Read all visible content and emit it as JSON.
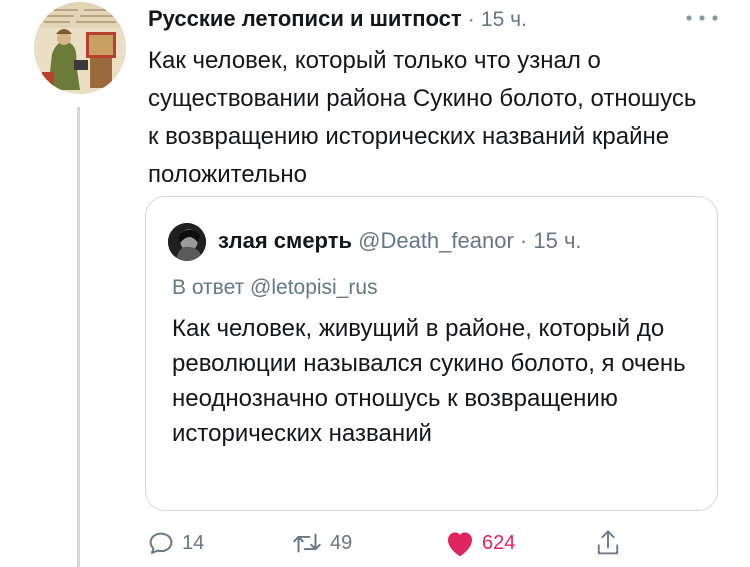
{
  "tweet": {
    "author": "Русские летописи и шитпост",
    "separator": "·",
    "time": "15 ч.",
    "text": "Как человек, который только что узнал о существовании района Сукино болото, отношусь к возвращению исторических названий крайне положительно"
  },
  "quoted_tweet": {
    "author": "злая смерть",
    "handle": "@Death_feanor",
    "separator": "·",
    "time": "15 ч.",
    "reply_to": "В ответ @letopisi_rus",
    "text": "Как человек, живущий в районе, который до революции назывался сукино болото, я очень неоднозначно отношусь к возвращению исторических названий"
  },
  "actions": {
    "replies": "14",
    "retweets": "49",
    "likes": "624"
  },
  "colors": {
    "text": "#14171a",
    "secondary": "#657786",
    "border": "#cfd9de",
    "like": "#e0245e"
  },
  "icons": [
    "more-icon",
    "reply-icon",
    "retweet-icon",
    "like-icon",
    "share-icon"
  ]
}
